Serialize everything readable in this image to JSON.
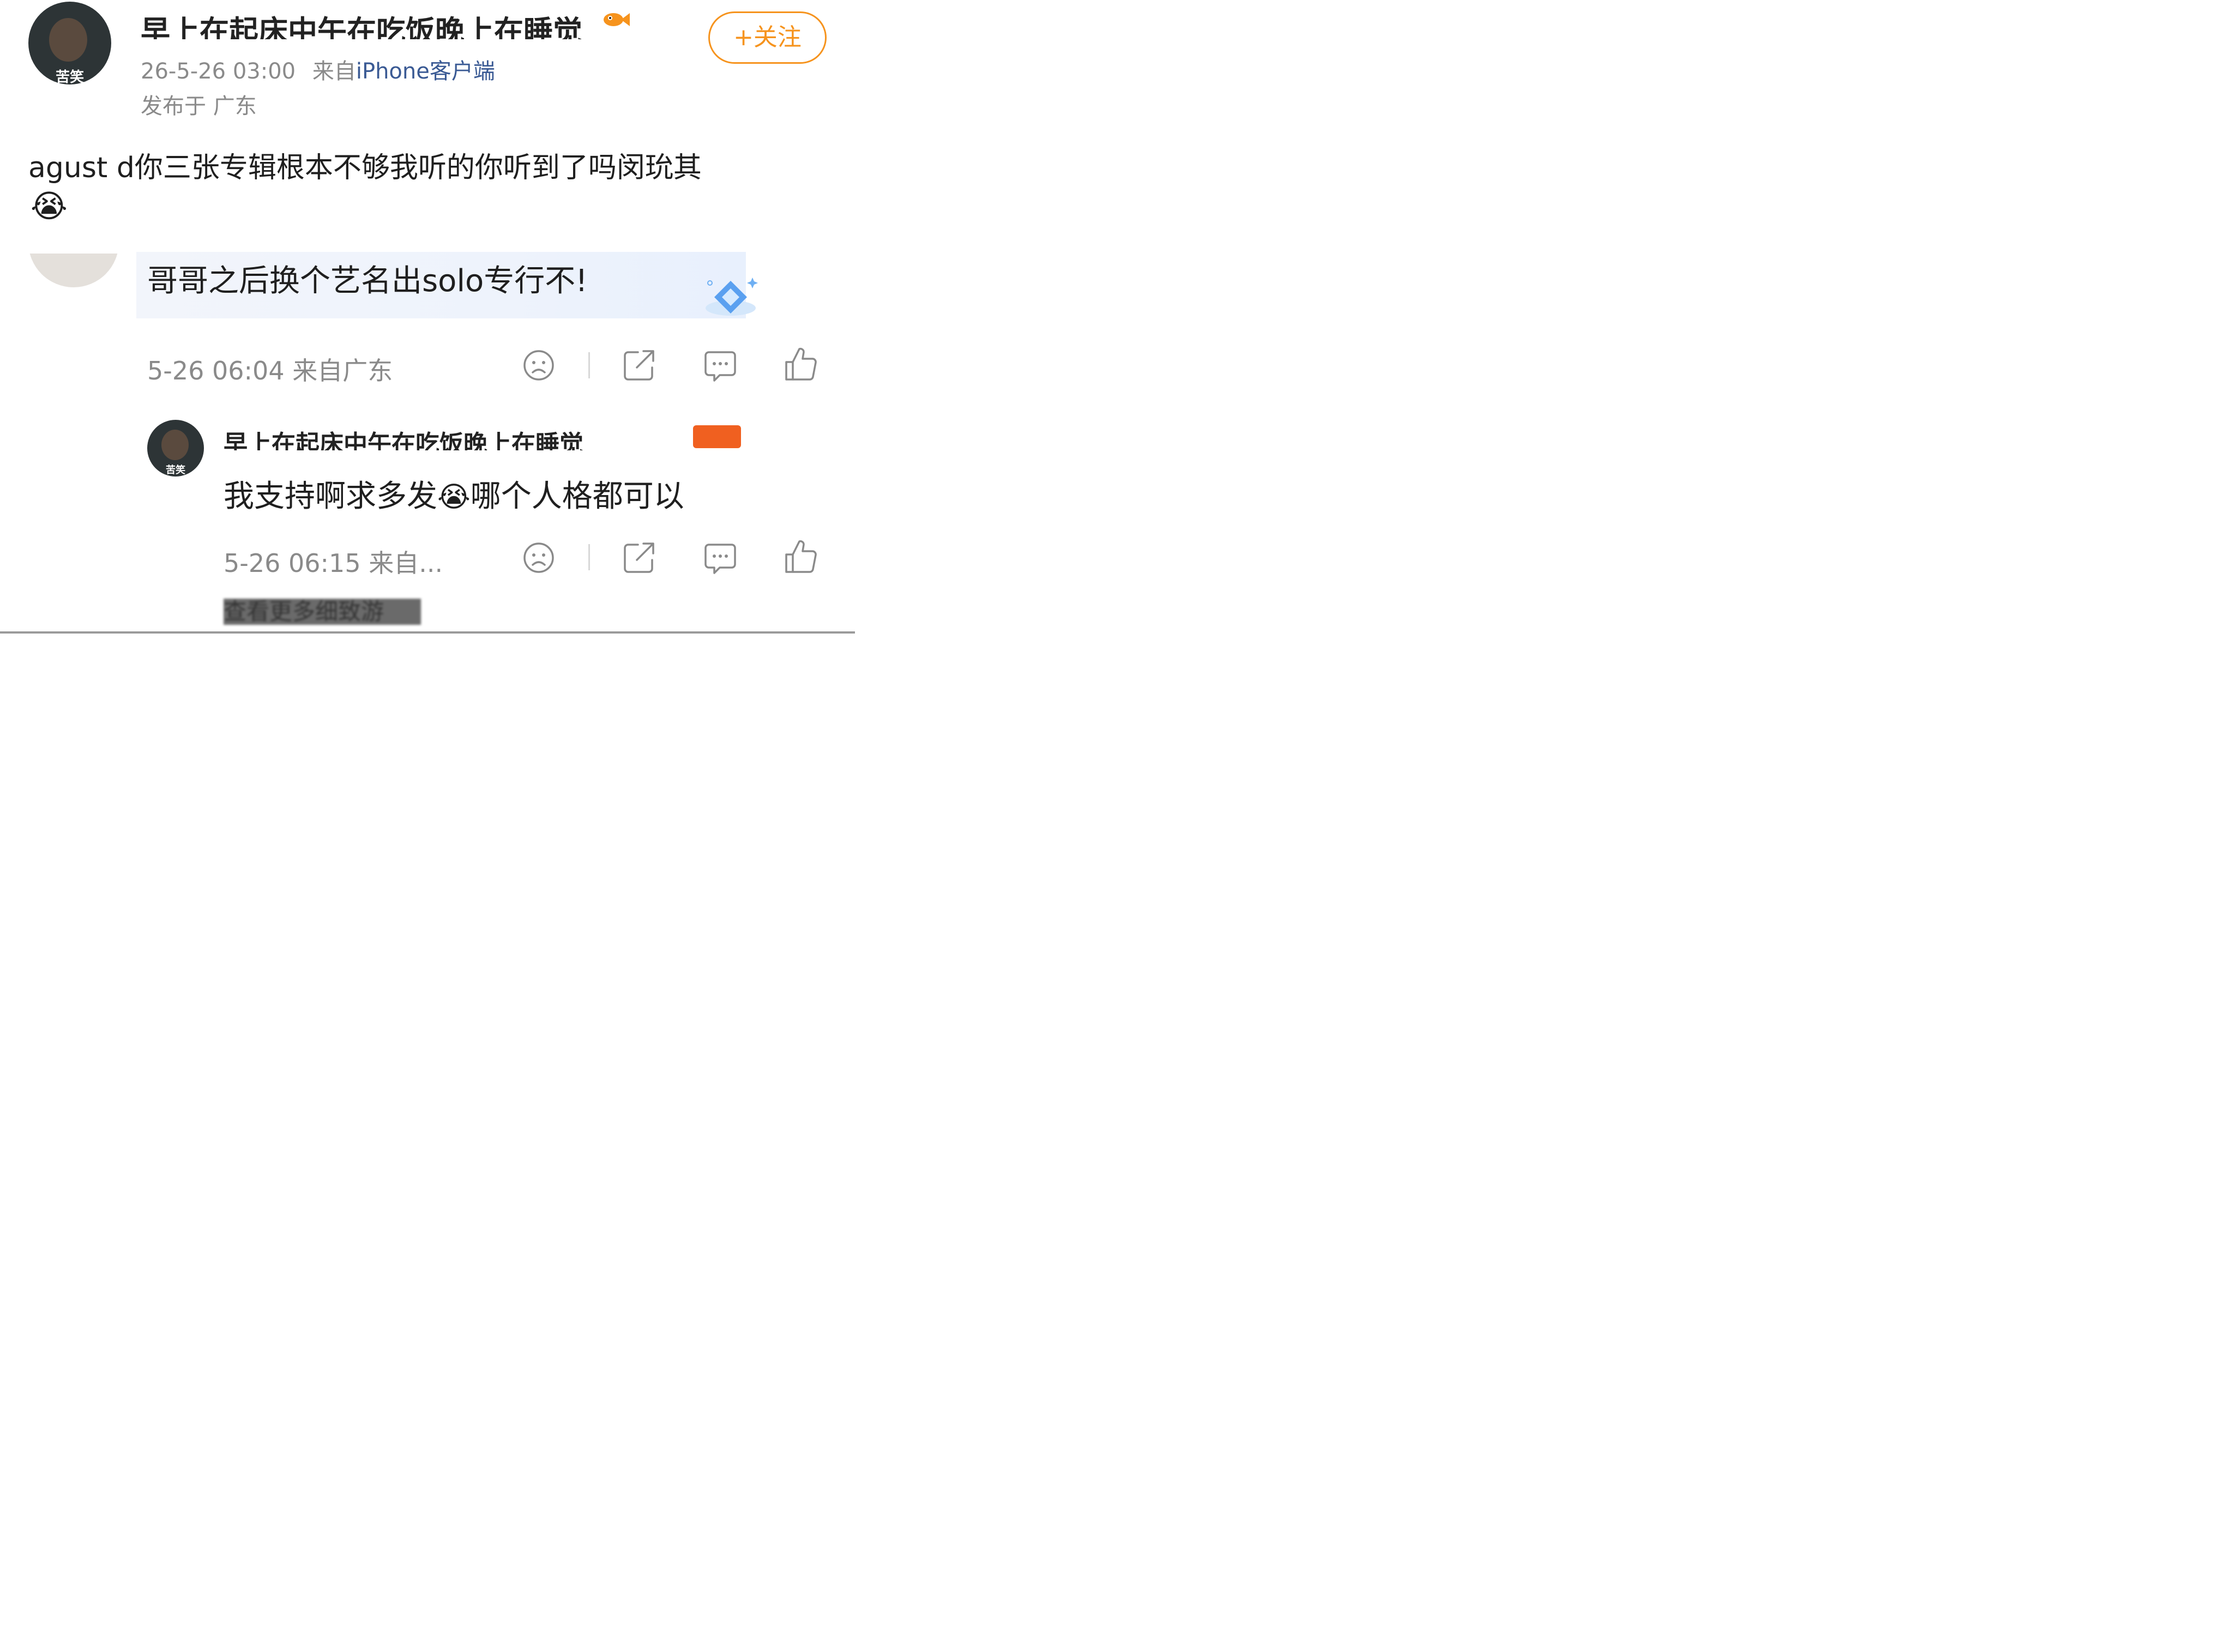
{
  "post": {
    "author": "早上在起床中午在吃饭晚上在睡觉",
    "avatar_caption": "苦笑",
    "date": "26-5-26 03:00",
    "from_label": "来自",
    "client": "iPhone客户端",
    "location": "发布于 广东",
    "follow_label": "+关注",
    "text": "agust d你三张专辑根本不够我听的你听到了吗闵玧其",
    "emoji": "😭"
  },
  "comment": {
    "text": "哥哥之后换个艺名出solo专行不!",
    "meta": "5-26 06:04 来自广东"
  },
  "reply": {
    "author": "早上在起床中午在吃饭晚上在睡觉",
    "avatar_caption": "苦笑",
    "text_part1": "我支持啊求多发",
    "emoji": "😭",
    "text_part2": "哪个人格都可以",
    "meta": "5-26 06:15 来自..."
  },
  "more_link": "查看更多细致游",
  "icons": [
    "sad-face-icon",
    "share-icon",
    "comment-icon",
    "like-icon"
  ],
  "colors": {
    "accent": "#f6931d",
    "meta": "#8a8a8a",
    "link": "#3a5a94"
  }
}
